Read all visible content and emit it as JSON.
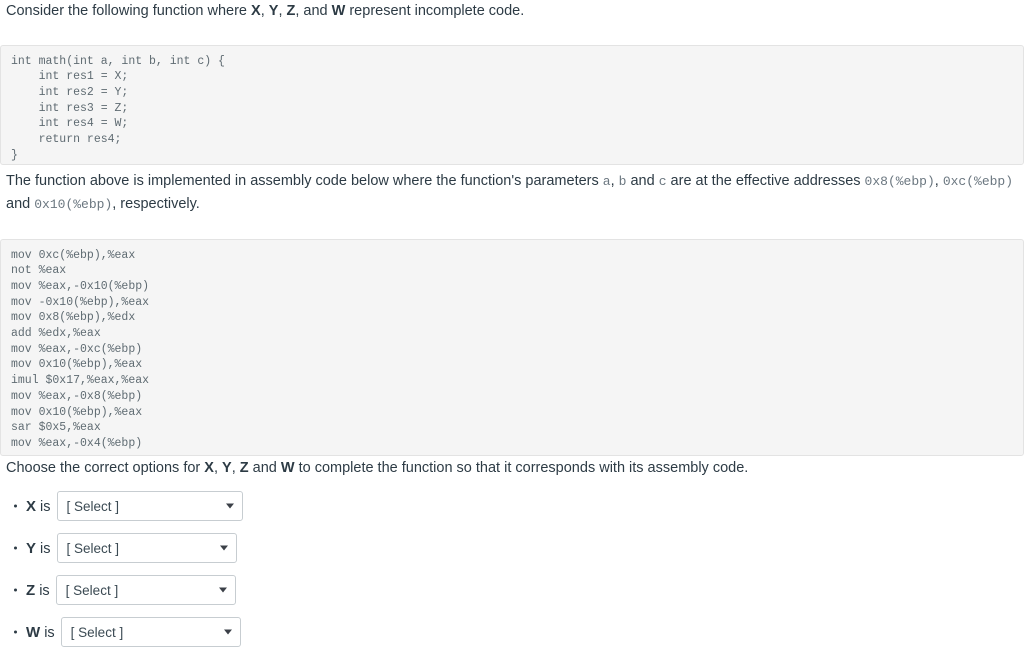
{
  "intro": {
    "text_before": "Consider the following function where ",
    "var_x": "X",
    "sep1": ", ",
    "var_y": "Y",
    "sep2": ", ",
    "var_z": "Z",
    "sep3": ", and ",
    "var_w": "W",
    "text_after": " represent incomplete code."
  },
  "c_code": {
    "lines": [
      "int math(int a, int b, int c) {",
      "    int res1 = X;",
      "    int res2 = Y;",
      "    int res3 = Z;",
      "    int res4 = W;",
      "    return res4;",
      "}"
    ],
    "content": "int math(int a, int b, int c) {\n    int res1 = X;\n    int res2 = Y;\n    int res3 = Z;\n    int res4 = W;\n    return res4;\n}"
  },
  "para_mid": {
    "part1": "The function above is implemented in assembly code below where the function's parameters ",
    "param_a": "a",
    "sep_a": ", ",
    "param_b": "b",
    "sep_b": " and ",
    "param_c": "c",
    "part2": " are at the effective addresses ",
    "addr1": "0x8(%ebp)",
    "sep_addr1": ", ",
    "addr2": "0xc(%ebp)",
    "part3": " and ",
    "addr3": "0x10(%ebp)",
    "part4": ", respectively."
  },
  "asm_code": {
    "lines": [
      "mov 0xc(%ebp),%eax",
      "not %eax",
      "mov %eax,-0x10(%ebp)",
      "mov -0x10(%ebp),%eax",
      "mov 0x8(%ebp),%edx",
      "add %edx,%eax",
      "mov %eax,-0xc(%ebp)",
      "mov 0x10(%ebp),%eax",
      "imul $0x17,%eax,%eax",
      "mov %eax,-0x8(%ebp)",
      "mov 0x10(%ebp),%eax",
      "sar $0x5,%eax",
      "mov %eax,-0x4(%ebp)"
    ],
    "content": "mov 0xc(%ebp),%eax\nnot %eax\nmov %eax,-0x10(%ebp)\nmov -0x10(%ebp),%eax\nmov 0x8(%ebp),%edx\nadd %edx,%eax\nmov %eax,-0xc(%ebp)\nmov 0x10(%ebp),%eax\nimul $0x17,%eax,%eax\nmov %eax,-0x8(%ebp)\nmov 0x10(%ebp),%eax\nsar $0x5,%eax\nmov %eax,-0x4(%ebp)"
  },
  "para_choose": {
    "part1": "Choose the correct options for ",
    "var_x": "X",
    "sep1": ", ",
    "var_y": "Y",
    "sep2": ", ",
    "var_z": "Z",
    "sep3": " and ",
    "var_w": "W",
    "part2": " to complete the function so that it corresponds with its assembly code."
  },
  "answers": [
    {
      "var": "X",
      "is": " is",
      "select_value": "[ Select ]",
      "caret": "chevron-down-icon"
    },
    {
      "var": "Y",
      "is": " is",
      "select_value": "[ Select ]",
      "caret": "chevron-down-icon"
    },
    {
      "var": "Z",
      "is": " is",
      "select_value": "[ Select ]",
      "caret": "chevron-down-icon"
    },
    {
      "var": "W",
      "is": " is",
      "select_value": "[ Select ]",
      "caret": "chevron-down-icon"
    }
  ],
  "colors": {
    "text": "#2d3b45",
    "code_bg": "#f5f5f5",
    "code_border": "#e3e3e3",
    "code_text": "#5f6b72",
    "select_border": "#c7cdd1",
    "inline_code_text": "#6b7780"
  }
}
